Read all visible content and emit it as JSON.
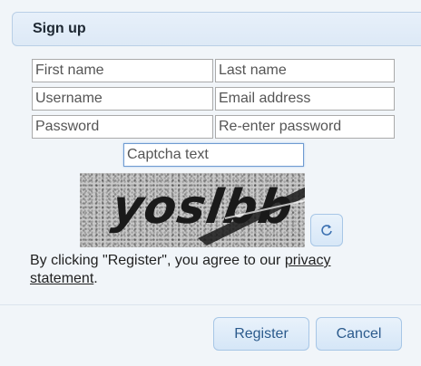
{
  "dialog": {
    "title": "Sign up"
  },
  "form": {
    "first_name": {
      "placeholder": "First name"
    },
    "last_name": {
      "placeholder": "Last name"
    },
    "username": {
      "placeholder": "Username"
    },
    "email": {
      "placeholder": "Email address"
    },
    "password": {
      "placeholder": "Password"
    },
    "password_confirm": {
      "placeholder": "Re-enter password"
    },
    "captcha": {
      "placeholder": "Captcha text",
      "image_text": "yoslbb"
    }
  },
  "refresh_icon": "refresh-icon",
  "terms": {
    "prefix": "By clicking \"Register\", you agree to our ",
    "link": "privacy statement",
    "suffix": "."
  },
  "buttons": {
    "register": "Register",
    "cancel": "Cancel"
  },
  "colors": {
    "accent": "#2b5a8c",
    "header_bg": "#e7f0fa",
    "button_bg": "#d5e6f7"
  }
}
